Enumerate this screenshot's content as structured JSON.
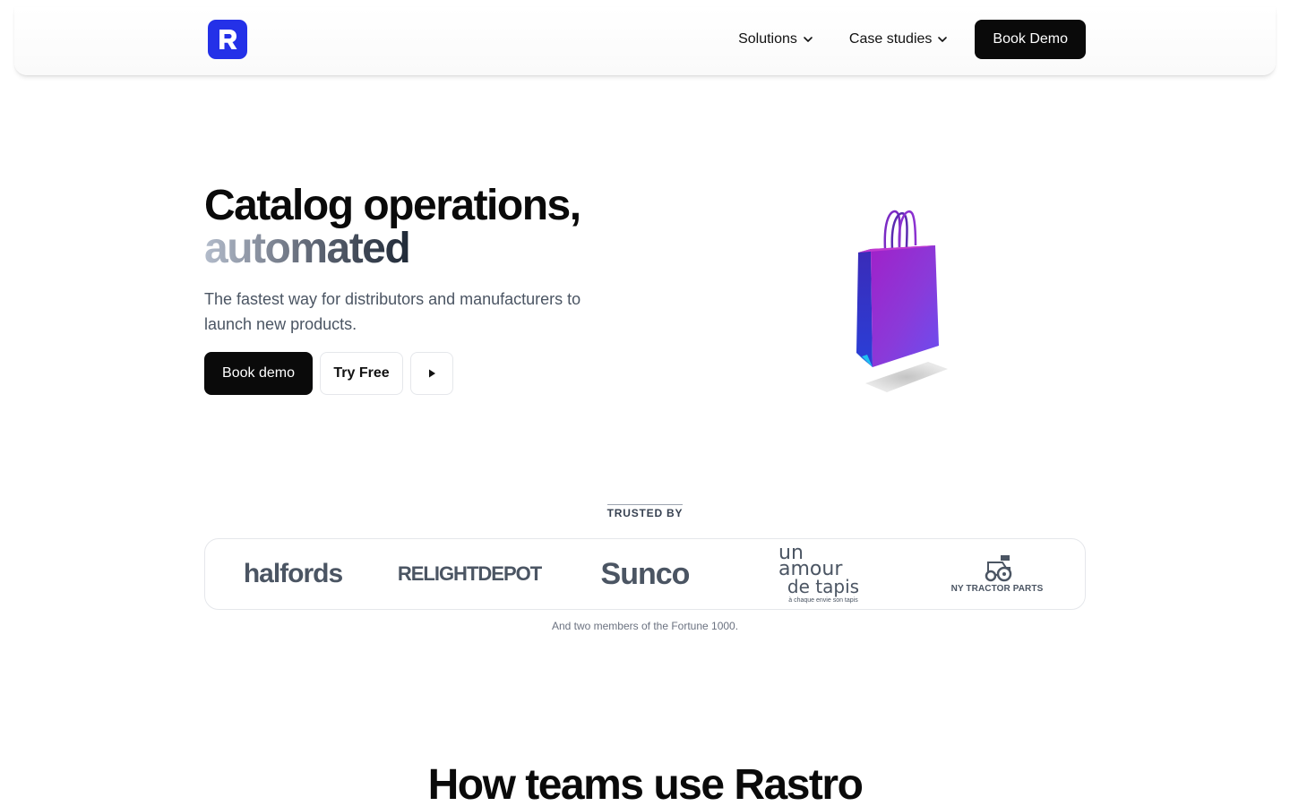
{
  "nav": {
    "logo_letter": "R",
    "brand_color": "#2431e8",
    "links": [
      {
        "label": "Solutions",
        "icon": "chevron-down-icon"
      },
      {
        "label": "Case studies",
        "icon": "chevron-down-icon"
      }
    ],
    "cta_label": "Book Demo"
  },
  "hero": {
    "title_line1": "Catalog operations,",
    "title_line2": "automated",
    "subtitle": "The fastest way for distributors and manufacturers to launch new products.",
    "primary_button": "Book demo",
    "secondary_button": "Try Free",
    "play_icon": "play-icon",
    "visual_icon": "shopping-bag-icon"
  },
  "trusted": {
    "label": "TRUSTED BY",
    "brands": {
      "halfords": "halfords",
      "relight": "RELIGHTDEPOT",
      "sunco": "Sunco",
      "amour_line1": "un amour",
      "amour_line2": "de tapis",
      "amour_line3": "à chaque envie son tapis",
      "ny": "NY TRACTOR PARTS"
    },
    "note": "And two members of the Fortune 1000."
  },
  "section": {
    "title": "How teams use Rastro"
  }
}
